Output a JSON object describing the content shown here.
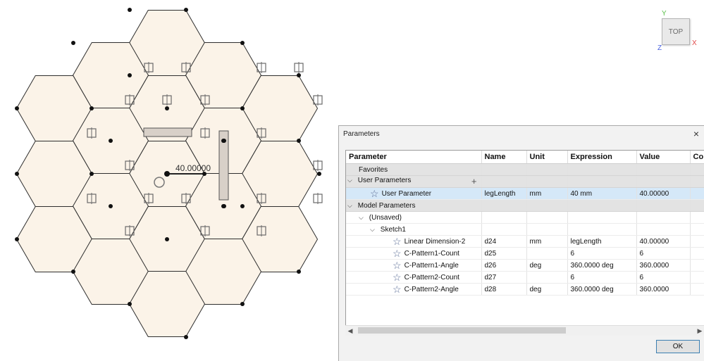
{
  "dialog": {
    "title": "Parameters",
    "close_glyph": "×",
    "ok_label": "OK",
    "columns": [
      "Parameter",
      "Name",
      "Unit",
      "Expression",
      "Value",
      "Co"
    ],
    "groups": {
      "favorites": "Favorites",
      "user_parameters": "User Parameters",
      "model_parameters": "Model Parameters",
      "unsaved": "(Unsaved)",
      "sketch": "Sketch1"
    },
    "user_rows": [
      {
        "parameter": "User Parameter",
        "name": "legLength",
        "unit": "mm",
        "expression": "40 mm",
        "value": "40.00000"
      }
    ],
    "model_rows": [
      {
        "parameter": "Linear Dimension-2",
        "name": "d24",
        "unit": "mm",
        "expression": "legLength",
        "value": "40.00000"
      },
      {
        "parameter": "C-Pattern1-Count",
        "name": "d25",
        "unit": "",
        "expression": "6",
        "value": "6"
      },
      {
        "parameter": "C-Pattern1-Angle",
        "name": "d26",
        "unit": "deg",
        "expression": "360.0000 deg",
        "value": "360.0000"
      },
      {
        "parameter": "C-Pattern2-Count",
        "name": "d27",
        "unit": "",
        "expression": "6",
        "value": "6"
      },
      {
        "parameter": "C-Pattern2-Angle",
        "name": "d28",
        "unit": "deg",
        "expression": "360.0000 deg",
        "value": "360.0000"
      }
    ]
  },
  "sketch": {
    "dimension_label": "40.00000"
  },
  "viewcube": {
    "face_label": "TOP",
    "axis_x": "X",
    "axis_y": "Y",
    "axis_z": "Z"
  },
  "icons": [
    "star-icon",
    "plus-icon",
    "chevron-down-icon",
    "close-icon",
    "constraint-glyph"
  ],
  "colors": {
    "hex_fill": "#fbf3e8",
    "selection": "#d5e8f8",
    "group_header": "#e3e3e3",
    "axis_x": "#e04a4a",
    "axis_y": "#5bbf4a",
    "axis_z": "#4a62e0"
  }
}
